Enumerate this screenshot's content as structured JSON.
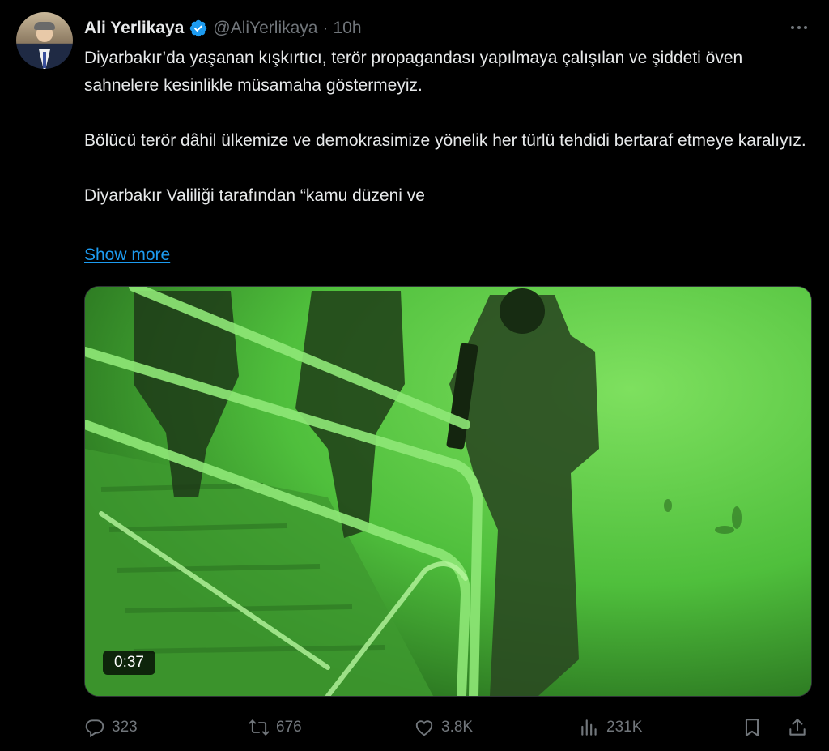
{
  "author": {
    "name": "Ali Yerlikaya",
    "handle": "@AliYerlikaya",
    "separator": "·",
    "time": "10h"
  },
  "tweet": {
    "paragraphs": [
      "Diyarbakır’da yaşanan kışkırtıcı, terör propagandası yapılmaya çalışılan ve şiddeti öven sahnelere kesinlikle müsamaha göstermeyiz.",
      "Bölücü terör dâhil ülkemize ve demokrasimize yönelik her türlü tehdidi bertaraf etmeye karalıyız.",
      "Diyarbakır Valiliği tarafından “kamu düzeni ve"
    ],
    "show_more_label": "Show more"
  },
  "video": {
    "duration": "0:37"
  },
  "actions": {
    "replies": "323",
    "reposts": "676",
    "likes": "3.8K",
    "views": "231K"
  },
  "icons": {
    "verified": "verified-badge-icon",
    "more": "more-icon",
    "reply": "reply-icon",
    "repost": "repost-icon",
    "like": "heart-icon",
    "views": "views-icon",
    "bookmark": "bookmark-icon",
    "share": "share-icon"
  },
  "colors": {
    "background": "#000000",
    "text": "#e7e9ea",
    "muted": "#71767b",
    "link": "#1d9bf0",
    "night_vision": "#4cb83a"
  }
}
